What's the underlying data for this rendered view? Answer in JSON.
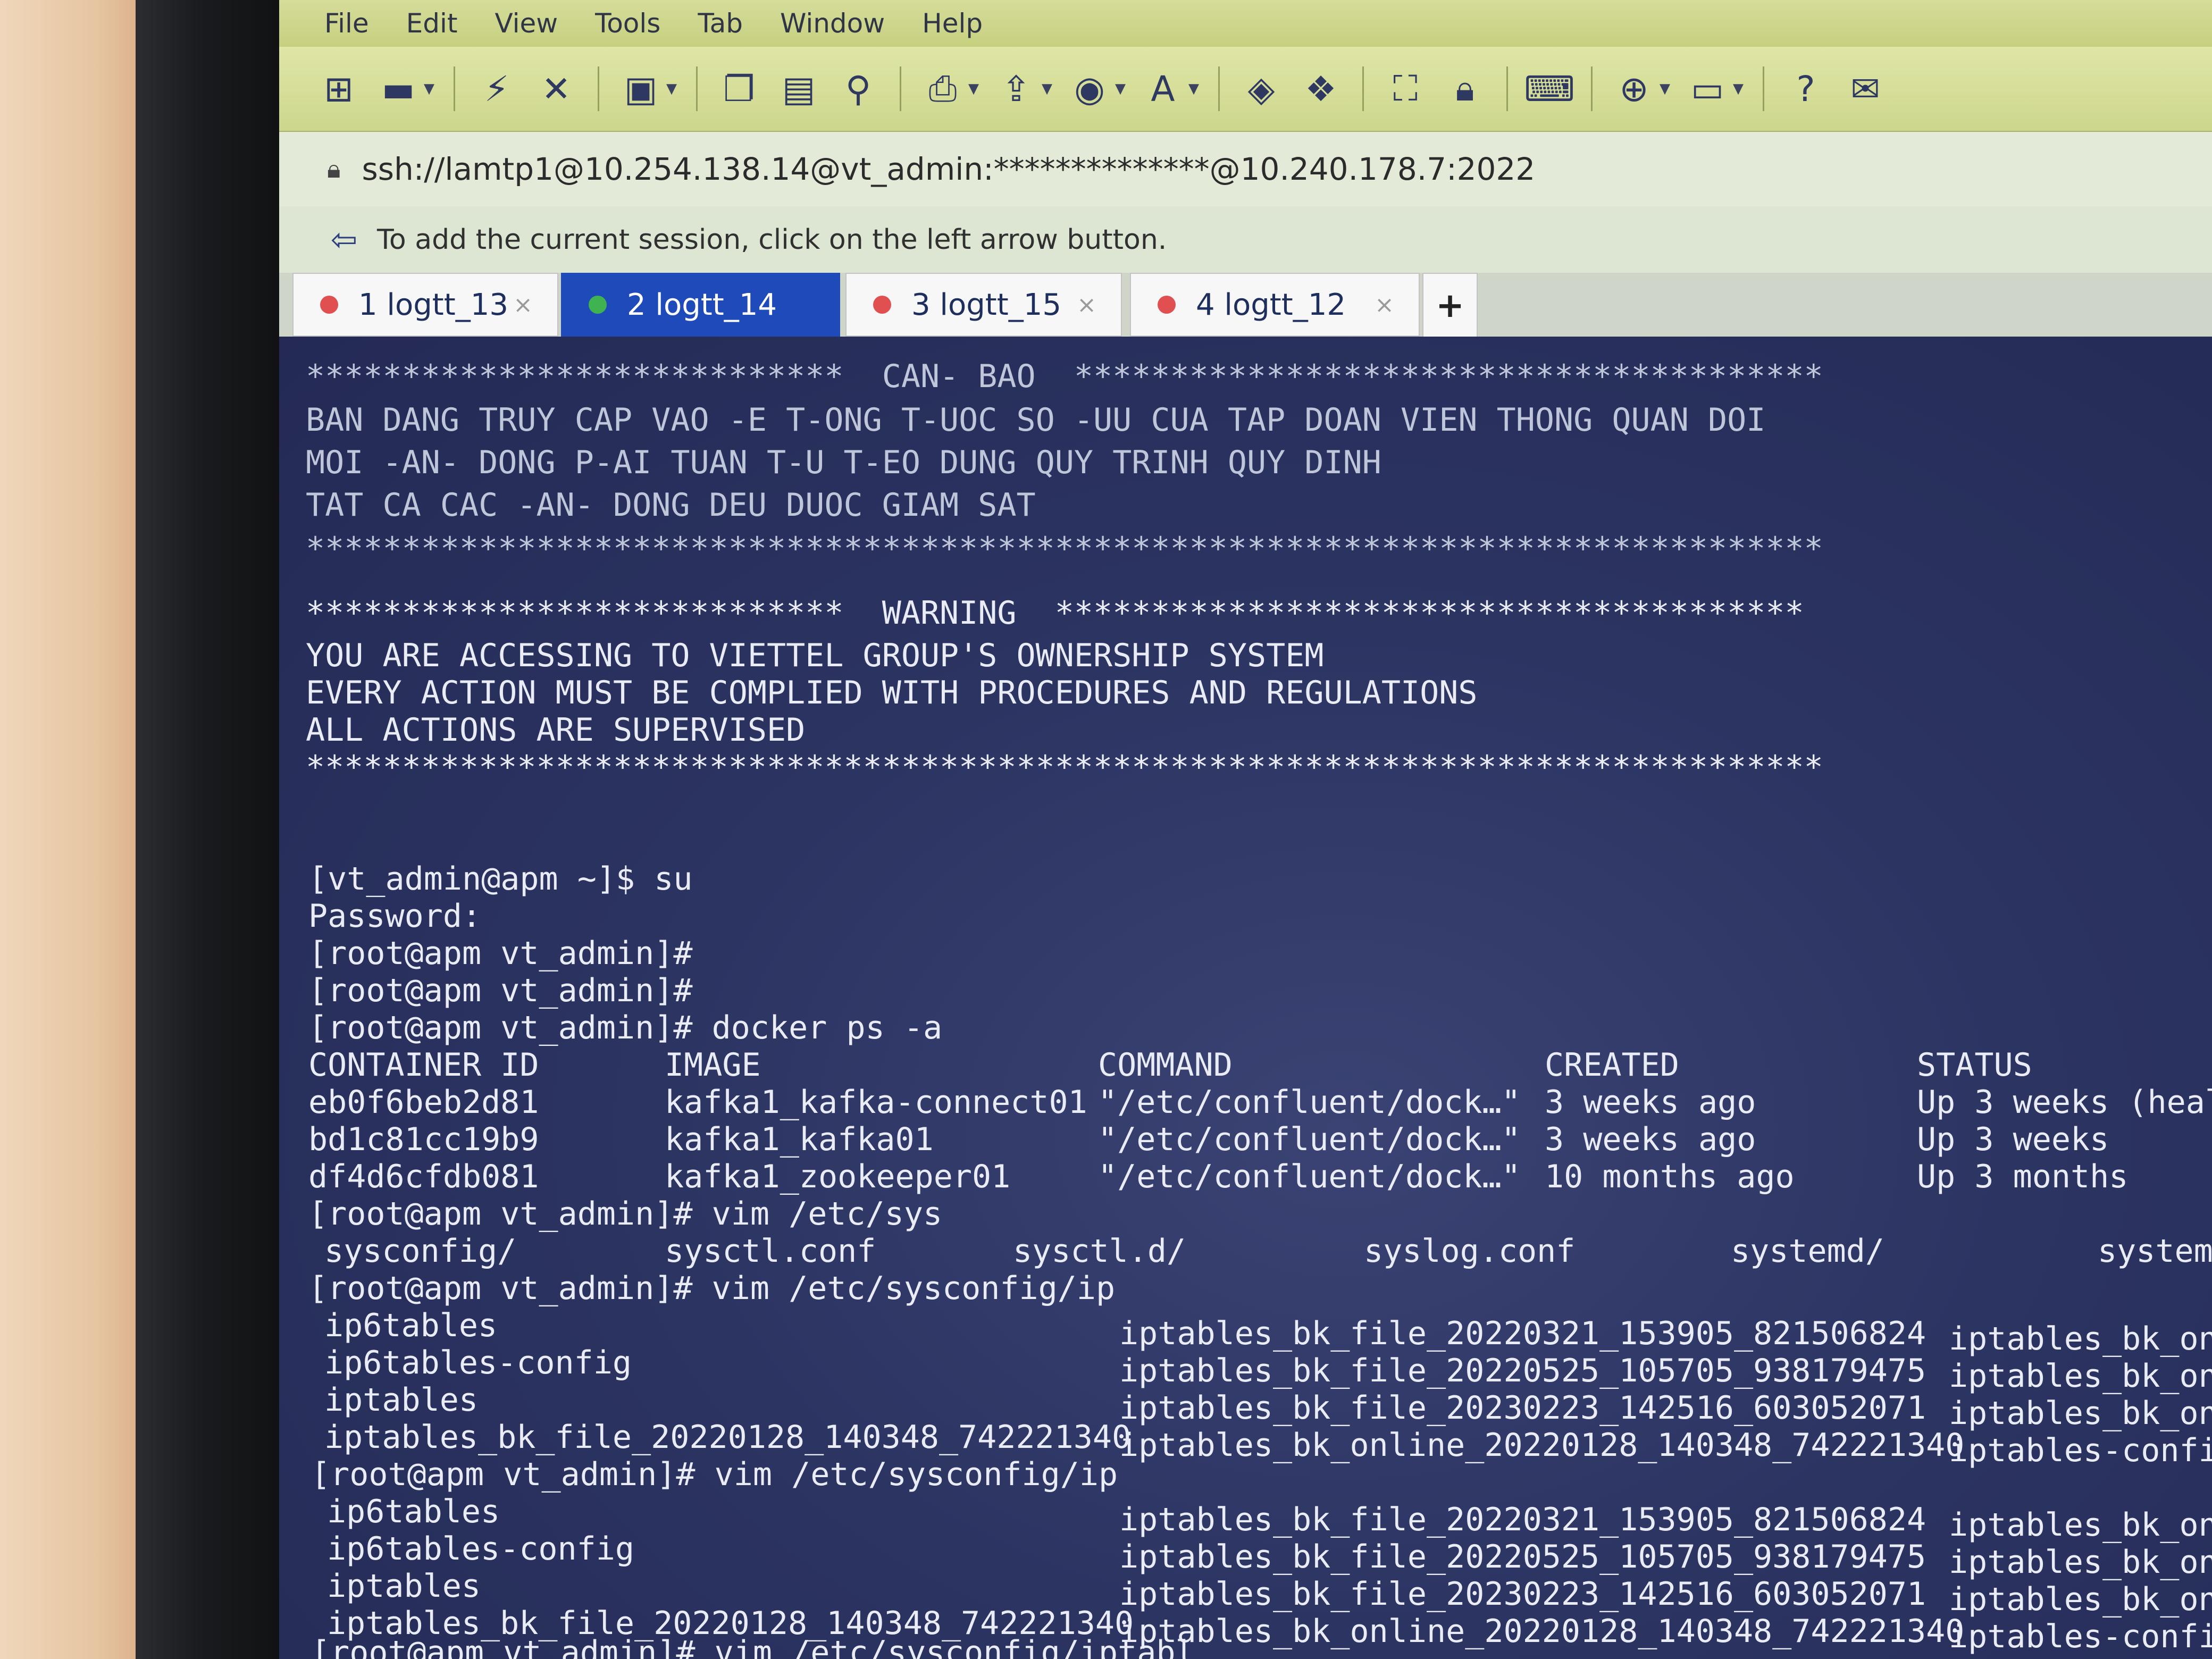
{
  "menu": [
    "File",
    "Edit",
    "View",
    "Tools",
    "Tab",
    "Window",
    "Help"
  ],
  "toolbar_icons": [
    "new-session-icon",
    "open-folder-icon",
    "chevron-down-icon",
    "reconnect-icon",
    "disconnect-icon",
    "properties-icon",
    "chevron-down-icon",
    "copy-icon",
    "paste-icon",
    "find-icon",
    "print-icon",
    "chevron-down-icon",
    "transfer-icon",
    "chevron-down-icon",
    "globe-icon",
    "chevron-down-icon",
    "font-icon",
    "chevron-down-icon",
    "script-icon",
    "xftp-icon",
    "fullscreen-icon",
    "lock-icon",
    "keyboard-icon",
    "new-tab-icon",
    "chevron-down-icon",
    "layout-icon",
    "chevron-down-icon",
    "help-icon",
    "chat-icon"
  ],
  "address": "ssh://lamtp1@10.254.138.14@vt_admin:**************@10.240.178.7:2022",
  "hint": "To add the current session, click on the left arrow button.",
  "tabs": [
    {
      "label": "1 logtt_13",
      "status_color": "#e05050"
    },
    {
      "label": "2 logtt_14",
      "status_color": "#3fb34f"
    },
    {
      "label": "3 logtt_15",
      "status_color": "#e05050"
    },
    {
      "label": "4 logtt_12",
      "status_color": "#e05050"
    }
  ],
  "tab_add": "+",
  "terminal": {
    "banner_vn": {
      "header": "****************************  CAN- BAO  ***************************************",
      "lines": [
        "BAN DANG TRUY CAP VAO -E T-ONG T-UOC SO -UU CUA TAP DOAN VIEN THONG QUAN DOI",
        "MOI -AN- DONG P-AI TUAN T-U T-EO DUNG QUY TRINH QUY DINH",
        "TAT CA CAC -AN- DONG DEU DUOC GIAM SAT"
      ],
      "footer": "*******************************************************************************"
    },
    "banner_en": {
      "header": "****************************  WARNING  ***************************************",
      "lines": [
        "YOU ARE ACCESSING TO VIETTEL GROUP'S OWNERSHIP SYSTEM",
        "EVERY ACTION MUST BE COMPLIED WITH PROCEDURES AND REGULATIONS",
        "ALL ACTIONS ARE SUPERVISED"
      ],
      "footer": "*******************************************************************************"
    },
    "session": [
      "[vt_admin@apm ~]$ su",
      "Password:",
      "[root@apm vt_admin]#",
      "[root@apm vt_admin]#",
      "[root@apm vt_admin]# docker ps -a"
    ],
    "docker_headers": [
      "CONTAINER ID",
      "IMAGE",
      "COMMAND",
      "CREATED",
      "STATUS"
    ],
    "docker_rows": [
      [
        "eb0f6beb2d81",
        "kafka1_kafka-connect01",
        "\"/etc/confluent/dock…\"",
        "3 weeks ago",
        "Up 3 weeks (heal"
      ],
      [
        "bd1c81cc19b9",
        "kafka1_kafka01",
        "\"/etc/confluent/dock…\"",
        "3 weeks ago",
        "Up 3 weeks"
      ],
      [
        "df4d6cfdb081",
        "kafka1_zookeeper01",
        "\"/etc/confluent/dock…\"",
        "10 months ago",
        "Up 3 months"
      ]
    ],
    "vim_sys_cmd": "[root@apm vt_admin]# vim /etc/sys",
    "sys_completions": [
      "sysconfig/",
      "sysctl.conf",
      "sysctl.d/",
      "syslog.conf",
      "systemd/",
      "system"
    ],
    "vim_ip_cmd": "[root@apm vt_admin]# vim /etc/sysconfig/ip",
    "ip_col1": [
      "ip6tables",
      "ip6tables-config",
      "iptables",
      "iptables_bk_file_20220128_140348_742221340"
    ],
    "ip_col2": [
      "iptables_bk_file_20220321_153905_821506824",
      "iptables_bk_file_20220525_105705_938179475",
      "iptables_bk_file_20230223_142516_603052071",
      "iptables_bk_online_20220128_140348_742221340"
    ],
    "ip_col3": [
      "iptables_bk_onl",
      "iptables_bk_onl",
      "iptables_bk_onl",
      "iptables-confi"
    ],
    "vim_ip_cmd2": "[root@apm vt_admin]# vim /etc/sysconfig/ip",
    "ip2_col1": [
      "ip6tables",
      "ip6tables-config",
      "iptables",
      "iptables_bk_file_20220128_140348_742221340"
    ],
    "ip2_col2": [
      "iptables_bk_file_20220321_153905_821506824",
      "iptables_bk_file_20220525_105705_938179475",
      "iptables_bk_file_20230223_142516_603052071",
      "iptables_bk_online_20220128_140348_742221340"
    ],
    "ip2_col3": [
      "iptables_bk_onl",
      "iptables_bk_onl",
      "iptables_bk_onl",
      "iptables-confi"
    ],
    "last_line": "[root@apm vt_admin]# vim /etc/sysconfig/iptabl"
  }
}
